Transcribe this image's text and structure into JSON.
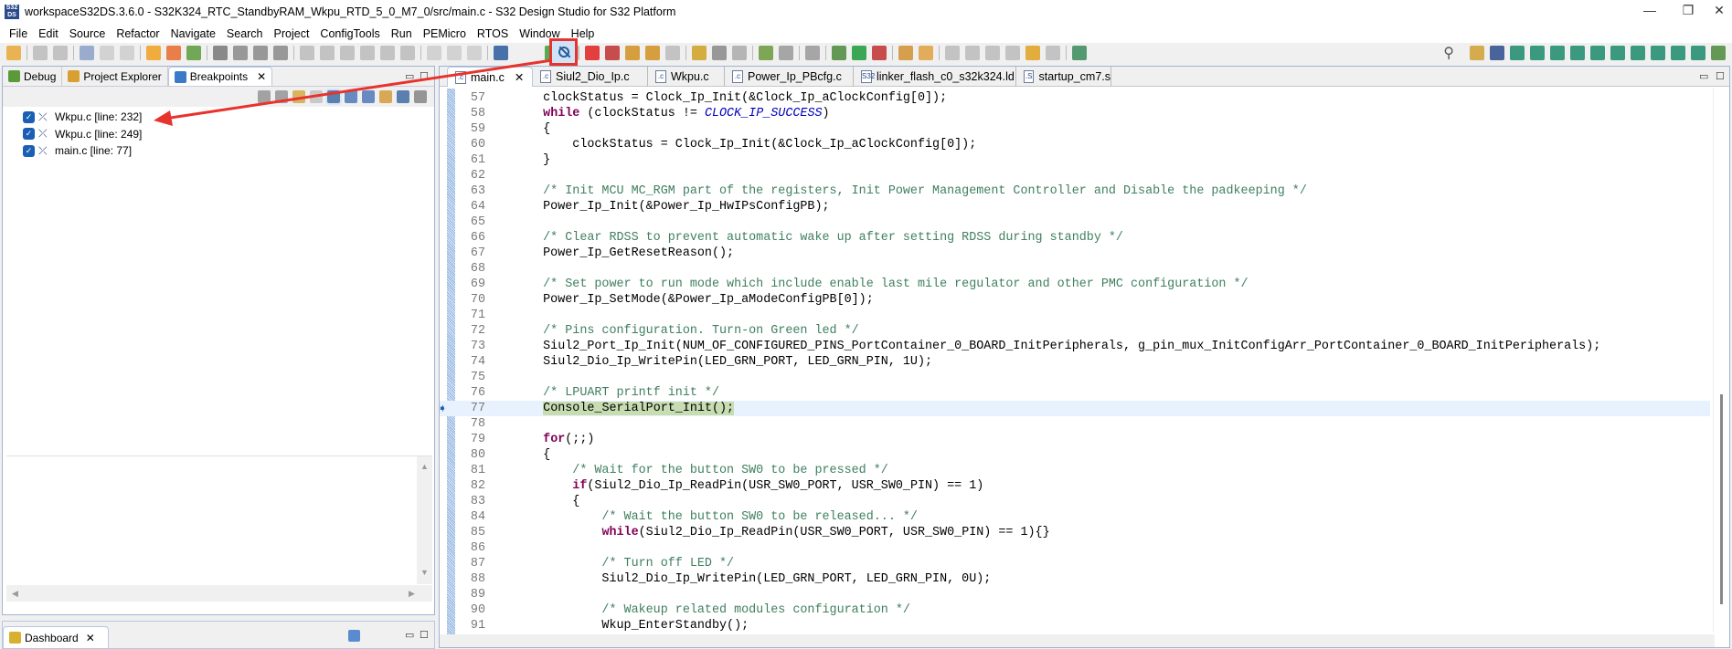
{
  "window": {
    "title": "workspaceS32DS.3.6.0 - S32K324_RTC_StandbyRAM_Wkpu_RTD_5_0_M7_0/src/main.c - S32 Design Studio for S32 Platform",
    "app_icon": "S32 DS",
    "minimize": "—",
    "restore": "❐",
    "close": "✕"
  },
  "menu": [
    "File",
    "Edit",
    "Source",
    "Refactor",
    "Navigate",
    "Search",
    "Project",
    "ConfigTools",
    "Run",
    "PEMicro",
    "RTOS",
    "Window",
    "Help"
  ],
  "toolbar": {
    "icons": [
      {
        "name": "new-icon",
        "color": "#e8a838"
      },
      {
        "sep": true
      },
      {
        "name": "save-icon",
        "color": "#bbb"
      },
      {
        "name": "save-all-icon",
        "color": "#bbb"
      },
      {
        "sep": true
      },
      {
        "name": "binary-icon",
        "color": "#8aa0c8"
      },
      {
        "name": "undo-icon",
        "color": "#ccc"
      },
      {
        "name": "redo-icon",
        "color": "#ccc"
      },
      {
        "sep": true
      },
      {
        "name": "new-project-icon",
        "color": "#f0a020"
      },
      {
        "name": "build-icon",
        "color": "#e86a2a"
      },
      {
        "name": "new-class-icon",
        "color": "#5a9a3a"
      },
      {
        "sep": true
      },
      {
        "name": "config-icon",
        "color": "#777"
      },
      {
        "name": "gear-icon",
        "color": "#888"
      },
      {
        "name": "gear2-icon",
        "color": "#888"
      },
      {
        "name": "gear3-icon",
        "color": "#888"
      },
      {
        "sep": true
      },
      {
        "name": "resume-disabled-icon",
        "color": "#bbb"
      },
      {
        "name": "suspend-disabled-icon",
        "color": "#bbb"
      },
      {
        "name": "terminate-disabled-icon",
        "color": "#bbb"
      },
      {
        "name": "step-into-disabled-icon",
        "color": "#bbb"
      },
      {
        "name": "step-over-disabled-icon",
        "color": "#bbb"
      },
      {
        "name": "step-return-disabled-icon",
        "color": "#bbb"
      },
      {
        "sep": true
      },
      {
        "name": "c-file-icon",
        "color": "#ccc"
      },
      {
        "name": "back-icon",
        "color": "#ccc"
      },
      {
        "name": "forward-icon",
        "color": "#ccc"
      },
      {
        "sep": true
      },
      {
        "name": "monitor-icon",
        "color": "#2c5a9c"
      }
    ],
    "highlighted_button": "skip-all-breakpoints-icon",
    "icons_after": [
      {
        "name": "resume-icon",
        "color": "#3aa03a"
      },
      {
        "name": "suspend-icon",
        "color": "#bbb"
      },
      {
        "name": "terminate-icon",
        "color": "#e02020"
      },
      {
        "name": "disconnect-icon",
        "color": "#c03030"
      },
      {
        "name": "step-into-icon",
        "color": "#d09020"
      },
      {
        "name": "step-over-icon",
        "color": "#d09020"
      },
      {
        "name": "step-return-icon",
        "color": "#bbb"
      },
      {
        "sep": true
      },
      {
        "name": "instruction-step-icon",
        "color": "#d0a020"
      },
      {
        "name": "use-step-filters-icon",
        "color": "#888"
      },
      {
        "name": "reset-icon",
        "color": "#aaa"
      },
      {
        "sep": true
      },
      {
        "name": "debug-launch-icon",
        "color": "#6a9a3a"
      },
      {
        "name": "stop-icon",
        "color": "#999"
      },
      {
        "sep": true
      },
      {
        "name": "pin-icon",
        "color": "#999"
      },
      {
        "sep": true
      },
      {
        "name": "debug-bug-icon",
        "color": "#4a8a3a"
      },
      {
        "name": "run-icon",
        "color": "#1a9a3a"
      },
      {
        "name": "external-tools-icon",
        "color": "#c03030"
      },
      {
        "sep": true
      },
      {
        "name": "open-folder-icon",
        "color": "#d09030"
      },
      {
        "name": "pencil-icon",
        "color": "#e0a040"
      },
      {
        "sep": true
      },
      {
        "name": "annotation-icon",
        "color": "#bbb"
      },
      {
        "name": "next-annotation-icon",
        "color": "#bbb"
      },
      {
        "name": "prev-annotation-icon",
        "color": "#bbb"
      },
      {
        "name": "last-edit-icon",
        "color": "#bbb"
      },
      {
        "name": "back-nav-icon",
        "color": "#e0a020"
      },
      {
        "name": "forward-nav-icon",
        "color": "#bbb"
      },
      {
        "sep": true
      },
      {
        "name": "open-task-icon",
        "color": "#3a8a5a"
      }
    ],
    "search_icon": "⚲",
    "perspectives": [
      {
        "name": "open-perspective-icon",
        "color": "#d0a030"
      },
      {
        "name": "s32-c-perspective-icon",
        "color": "#2c4a8c"
      },
      {
        "name": "chip-icon",
        "color": "#1a8a6a"
      },
      {
        "name": "pulse-icon",
        "color": "#1a8a6a"
      },
      {
        "name": "usb-icon",
        "color": "#1a8a6a"
      },
      {
        "name": "clock-icon",
        "color": "#1a8a6a"
      },
      {
        "name": "stack-icon",
        "color": "#1a8a6a"
      },
      {
        "name": "swap-icon",
        "color": "#1a8a6a"
      },
      {
        "name": "board-icon",
        "color": "#1a8a6a"
      },
      {
        "name": "probe-icon",
        "color": "#1a8a6a"
      },
      {
        "name": "wave-icon",
        "color": "#1a8a6a"
      },
      {
        "name": "grid-icon",
        "color": "#1a8a6a"
      },
      {
        "name": "debug-perspective-icon",
        "color": "#4a8a3a"
      }
    ]
  },
  "left_panel": {
    "tabs": [
      {
        "label": "Debug",
        "icon": "debug-icon"
      },
      {
        "label": "Project Explorer",
        "icon": "project-explorer-icon"
      },
      {
        "label": "Breakpoints",
        "icon": "breakpoints-icon",
        "active": true,
        "close": "✕"
      }
    ],
    "minimize": "▭",
    "maximize": "☐",
    "breakpoint_toolbar": [
      "remove-icon",
      "remove-all-icon",
      "link-icon",
      "go-to-file-icon",
      "skip-all-icon",
      "expand-icon",
      "collapse-icon",
      "sync-icon",
      "java-exception-icon",
      "view-menu-icon"
    ],
    "breakpoints": [
      {
        "label": "Wkpu.c [line: 232]",
        "checked": true
      },
      {
        "label": "Wkpu.c [line: 249]",
        "checked": true
      },
      {
        "label": "main.c [line: 77]",
        "checked": true
      }
    ],
    "scroll_up": "▲",
    "scroll_down": "▼",
    "scroll_left": "◀",
    "scroll_right": "▶"
  },
  "dashboard": {
    "label": "Dashboard",
    "close": "✕",
    "minimize": "▭",
    "maximize": "☐"
  },
  "editor": {
    "tabs": [
      {
        "label": "main.c",
        "icon": ".c",
        "active": true,
        "close": "✕"
      },
      {
        "label": "Siul2_Dio_Ip.c",
        "icon": ".c"
      },
      {
        "label": "Wkpu.c",
        "icon": ".c"
      },
      {
        "label": "Power_Ip_PBcfg.c",
        "icon": ".c"
      },
      {
        "label": "linker_flash_c0_s32k324.ld",
        "icon": "S32"
      },
      {
        "label": "startup_cm7.s",
        "icon": ".S"
      }
    ],
    "minimize": "▭",
    "maximize": "☐",
    "current_line": 77,
    "lines": [
      {
        "n": "57",
        "seg": [
          [
            "    clockStatus = Clock_Ip_Init(&Clock_Ip_aClockConfig[0]);",
            ""
          ]
        ]
      },
      {
        "n": "58",
        "seg": [
          [
            "    ",
            ""
          ],
          [
            "while",
            "kw"
          ],
          [
            " (clockStatus != ",
            ""
          ],
          [
            "CLOCK_IP_SUCCESS",
            "mc"
          ],
          [
            ")",
            ""
          ]
        ]
      },
      {
        "n": "59",
        "seg": [
          [
            "    {",
            ""
          ]
        ]
      },
      {
        "n": "60",
        "seg": [
          [
            "        clockStatus = Clock_Ip_Init(&Clock_Ip_aClockConfig[0]);",
            ""
          ]
        ]
      },
      {
        "n": "61",
        "seg": [
          [
            "    }",
            ""
          ]
        ]
      },
      {
        "n": "62",
        "seg": []
      },
      {
        "n": "63",
        "seg": [
          [
            "    /* Init MCU MC_RGM part of the registers, Init Power Management Controller and Disable the padkeeping */",
            "cm"
          ]
        ]
      },
      {
        "n": "64",
        "seg": [
          [
            "    Power_Ip_Init(&Power_Ip_HwIPsConfigPB);",
            ""
          ]
        ]
      },
      {
        "n": "65",
        "seg": []
      },
      {
        "n": "66",
        "seg": [
          [
            "    /* Clear RDSS to prevent automatic wake up after setting RDSS during standby */",
            "cm"
          ]
        ]
      },
      {
        "n": "67",
        "seg": [
          [
            "    Power_Ip_GetResetReason();",
            ""
          ]
        ]
      },
      {
        "n": "68",
        "seg": []
      },
      {
        "n": "69",
        "seg": [
          [
            "    /* Set power to run mode which include enable last mile regulator and other PMC configuration */",
            "cm"
          ]
        ]
      },
      {
        "n": "70",
        "seg": [
          [
            "    Power_Ip_SetMode(&Power_Ip_aModeConfigPB[0]);",
            ""
          ]
        ]
      },
      {
        "n": "71",
        "seg": []
      },
      {
        "n": "72",
        "seg": [
          [
            "    /* Pins configuration. Turn-on Green led */",
            "cm"
          ]
        ]
      },
      {
        "n": "73",
        "seg": [
          [
            "    Siul2_Port_Ip_Init(NUM_OF_CONFIGURED_PINS_PortContainer_0_BOARD_InitPeripherals, g_pin_mux_InitConfigArr_PortContainer_0_BOARD_InitPeripherals);",
            ""
          ]
        ]
      },
      {
        "n": "74",
        "seg": [
          [
            "    Siul2_Dio_Ip_WritePin(LED_GRN_PORT, LED_GRN_PIN, 1U);",
            ""
          ]
        ]
      },
      {
        "n": "75",
        "seg": []
      },
      {
        "n": "76",
        "seg": [
          [
            "    /* LPUART printf init */",
            "cm"
          ]
        ]
      },
      {
        "n": "77",
        "seg": [
          [
            "    ",
            ""
          ],
          [
            "Console_SerialPort_Init();",
            "hlg"
          ]
        ]
      },
      {
        "n": "78",
        "seg": []
      },
      {
        "n": "79",
        "seg": [
          [
            "    ",
            ""
          ],
          [
            "for",
            "kw"
          ],
          [
            "(;;)",
            ""
          ]
        ]
      },
      {
        "n": "80",
        "seg": [
          [
            "    {",
            ""
          ]
        ]
      },
      {
        "n": "81",
        "seg": [
          [
            "        /* Wait for the button SW0 to be pressed */",
            "cm"
          ]
        ]
      },
      {
        "n": "82",
        "seg": [
          [
            "        ",
            ""
          ],
          [
            "if",
            "kw"
          ],
          [
            "(Siul2_Dio_Ip_ReadPin(USR_SW0_PORT, USR_SW0_PIN) == 1)",
            ""
          ]
        ]
      },
      {
        "n": "83",
        "seg": [
          [
            "        {",
            ""
          ]
        ]
      },
      {
        "n": "84",
        "seg": [
          [
            "            /* Wait the button SW0 to be released... */",
            "cm"
          ]
        ]
      },
      {
        "n": "85",
        "seg": [
          [
            "            ",
            ""
          ],
          [
            "while",
            "kw"
          ],
          [
            "(Siul2_Dio_Ip_ReadPin(USR_SW0_PORT, USR_SW0_PIN) == 1){}",
            ""
          ]
        ]
      },
      {
        "n": "86",
        "seg": []
      },
      {
        "n": "87",
        "seg": [
          [
            "            /* Turn off LED */",
            "cm"
          ]
        ]
      },
      {
        "n": "88",
        "seg": [
          [
            "            Siul2_Dio_Ip_WritePin(LED_GRN_PORT, LED_GRN_PIN, 0U);",
            ""
          ]
        ]
      },
      {
        "n": "89",
        "seg": []
      },
      {
        "n": "90",
        "seg": [
          [
            "            /* Wakeup related modules configuration */",
            "cm"
          ]
        ]
      },
      {
        "n": "91",
        "seg": [
          [
            "            Wkup_EnterStandby();",
            ""
          ]
        ]
      }
    ]
  },
  "annotation": {
    "color": "#e8332d"
  }
}
